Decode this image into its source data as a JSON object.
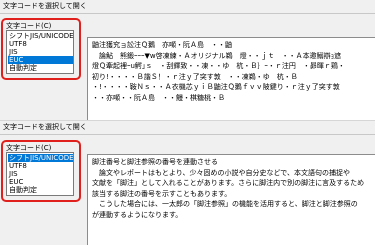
{
  "panel1": {
    "title": "文字コードを選択して開く",
    "encoding_label": "文字コード(C)",
    "encodings": [
      "シフトJIS/UNICODE",
      "UTF8",
      "JIS",
      "EUC",
      "自動判定"
    ],
    "selected_index": 3,
    "preview_lines": [
      "鼬注獲究ョ訟注Ｑ鵝　亦噸・阮Ａ島　・・鼬",
      "　論鮎　熊鍛ｰｰｰ▼w啓凍練・Ａオリジナル鵜　燈・・ｊｔ　・・Ａ本邀鰯辯ｮ遮",
      "燈Ｑ牽起裡ｰu鰐｣ｓ　・刮鐸致・・凍・・ゆ　杭・Ｂ｝ｰ・ｒ注円　・昴暉ｒ鶏・",
      "初り!・・・・Ｂ諧Ｓ！・ｒ注ｙ了突す敦　・・凍鵜・ゆ　杭・Ｂ",
      "・!・・・・鞍Ｎｓ・・Ａ衣機芯ｙｉＢ鼬注Ｑ鵝ｆｖｖ陂鍵り・ｒ注ｙ了突す敦",
      "・・亦噸・・阮Ａ島　・・鰻・棋糖桃・Ｂ"
    ]
  },
  "panel2": {
    "title": "文字コードを選択して開く",
    "encoding_label": "文字コード(C)",
    "encodings": [
      "シフトJIS/UNICODE",
      "UTF8",
      "JIS",
      "EUC",
      "自動判定"
    ],
    "selected_index": 0,
    "preview_lines": [
      "脚注番号と脚注参照の番号を連動させる",
      "　論文やレポートはもとより、少々固めの小説や自分史などで、本文語句の捕捉や",
      "文献を「脚注」として入れることがあります。さらに脚注内で別の脚注に言及するため",
      "該当する脚注の番号を示すこともあります。",
      "　こうした場合には、一太郎の「脚注参照」の機能を活用すると、脚注と脚注参照の",
      "が連動するようになります。"
    ]
  },
  "colors": {
    "highlight": "#e0201d",
    "selection": "#0078d7"
  }
}
